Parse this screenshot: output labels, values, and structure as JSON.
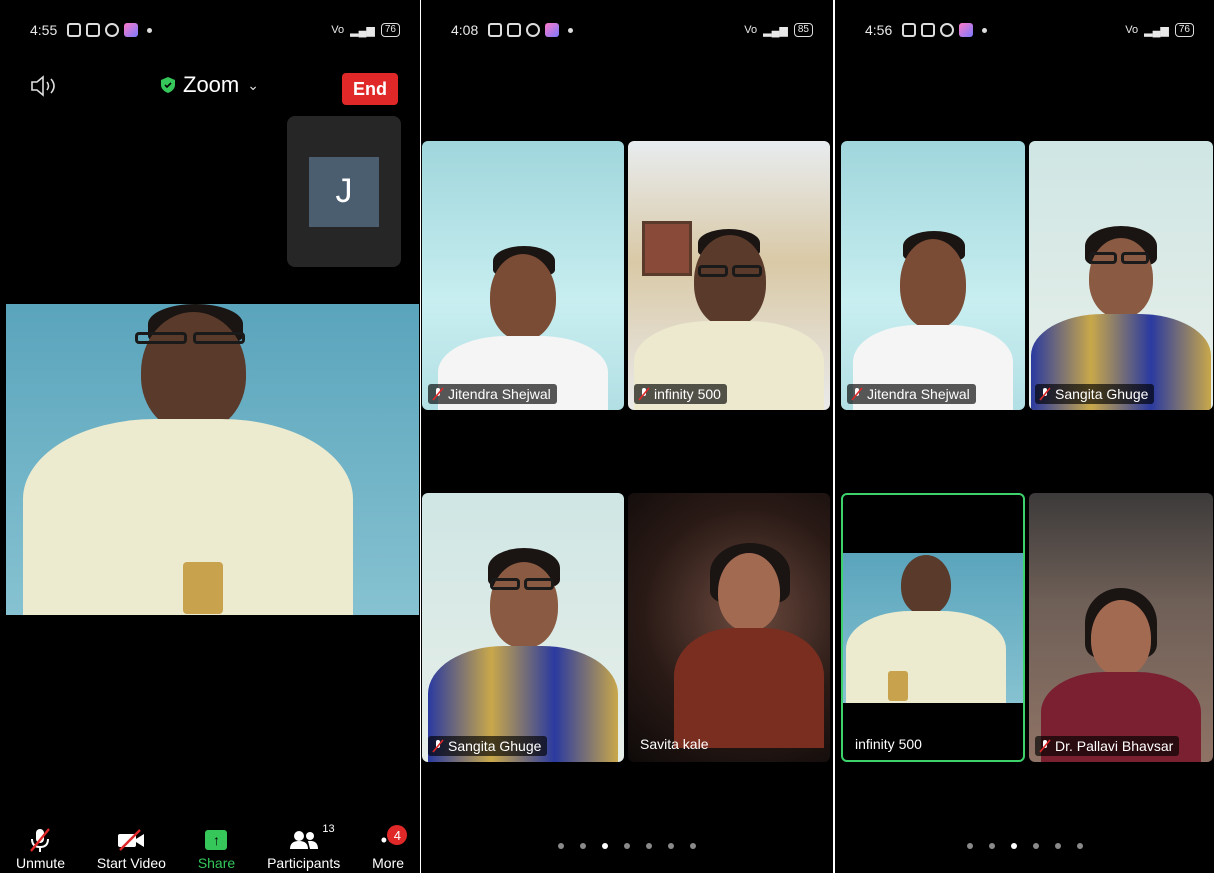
{
  "panel1": {
    "status": {
      "time": "4:55",
      "battery": "76"
    },
    "topbar": {
      "title": "Zoom",
      "end_label": "End"
    },
    "thumbnail": {
      "initial": "J"
    },
    "bottombar": {
      "unmute": "Unmute",
      "start_video": "Start Video",
      "share": "Share",
      "participants": "Participants",
      "participants_count": "13",
      "more": "More",
      "more_badge": "4"
    }
  },
  "panel2": {
    "status": {
      "time": "4:08",
      "battery": "85"
    },
    "tiles": [
      {
        "name": "Jitendra Shejwal",
        "muted": true
      },
      {
        "name": "infinity 500",
        "muted": true
      },
      {
        "name": "Sangita Ghuge",
        "muted": true
      },
      {
        "name": "Savita kale",
        "muted": false
      }
    ],
    "page_dots": 7,
    "active_dot": 3
  },
  "panel3": {
    "status": {
      "time": "4:56",
      "battery": "76"
    },
    "tiles": [
      {
        "name": "Jitendra Shejwal",
        "muted": true
      },
      {
        "name": "Sangita Ghuge",
        "muted": true
      },
      {
        "name": "infinity 500",
        "muted": false,
        "active_speaker": true
      },
      {
        "name": "Dr. Pallavi Bhavsar",
        "muted": true
      }
    ],
    "page_dots": 6,
    "active_dot": 3
  },
  "colors": {
    "end_red": "#e02828",
    "share_green": "#35c75a",
    "active_border": "#3dd26b"
  }
}
